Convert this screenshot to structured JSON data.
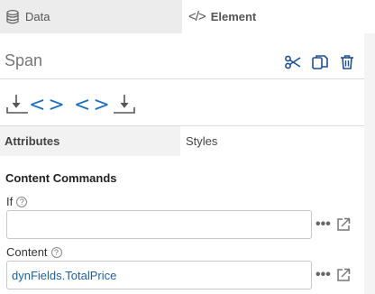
{
  "tabs": {
    "data_label": "Data",
    "element_label": "Element",
    "element_prefix": "</>"
  },
  "element": {
    "title": "Span"
  },
  "insert": {
    "before_label": "<>",
    "after_label": "<>"
  },
  "subtabs": {
    "attributes": "Attributes",
    "styles": "Styles"
  },
  "content_commands": {
    "title": "Content Commands",
    "if_label": "If",
    "if_value": "",
    "content_label": "Content",
    "content_value": "dynFields.TotalPrice",
    "more_glyph": "•••",
    "help_glyph": "?"
  },
  "colors": {
    "accent": "#1f6fbf",
    "icon_blue": "#1f4f8f",
    "tab_inactive_bg": "#ececec"
  }
}
